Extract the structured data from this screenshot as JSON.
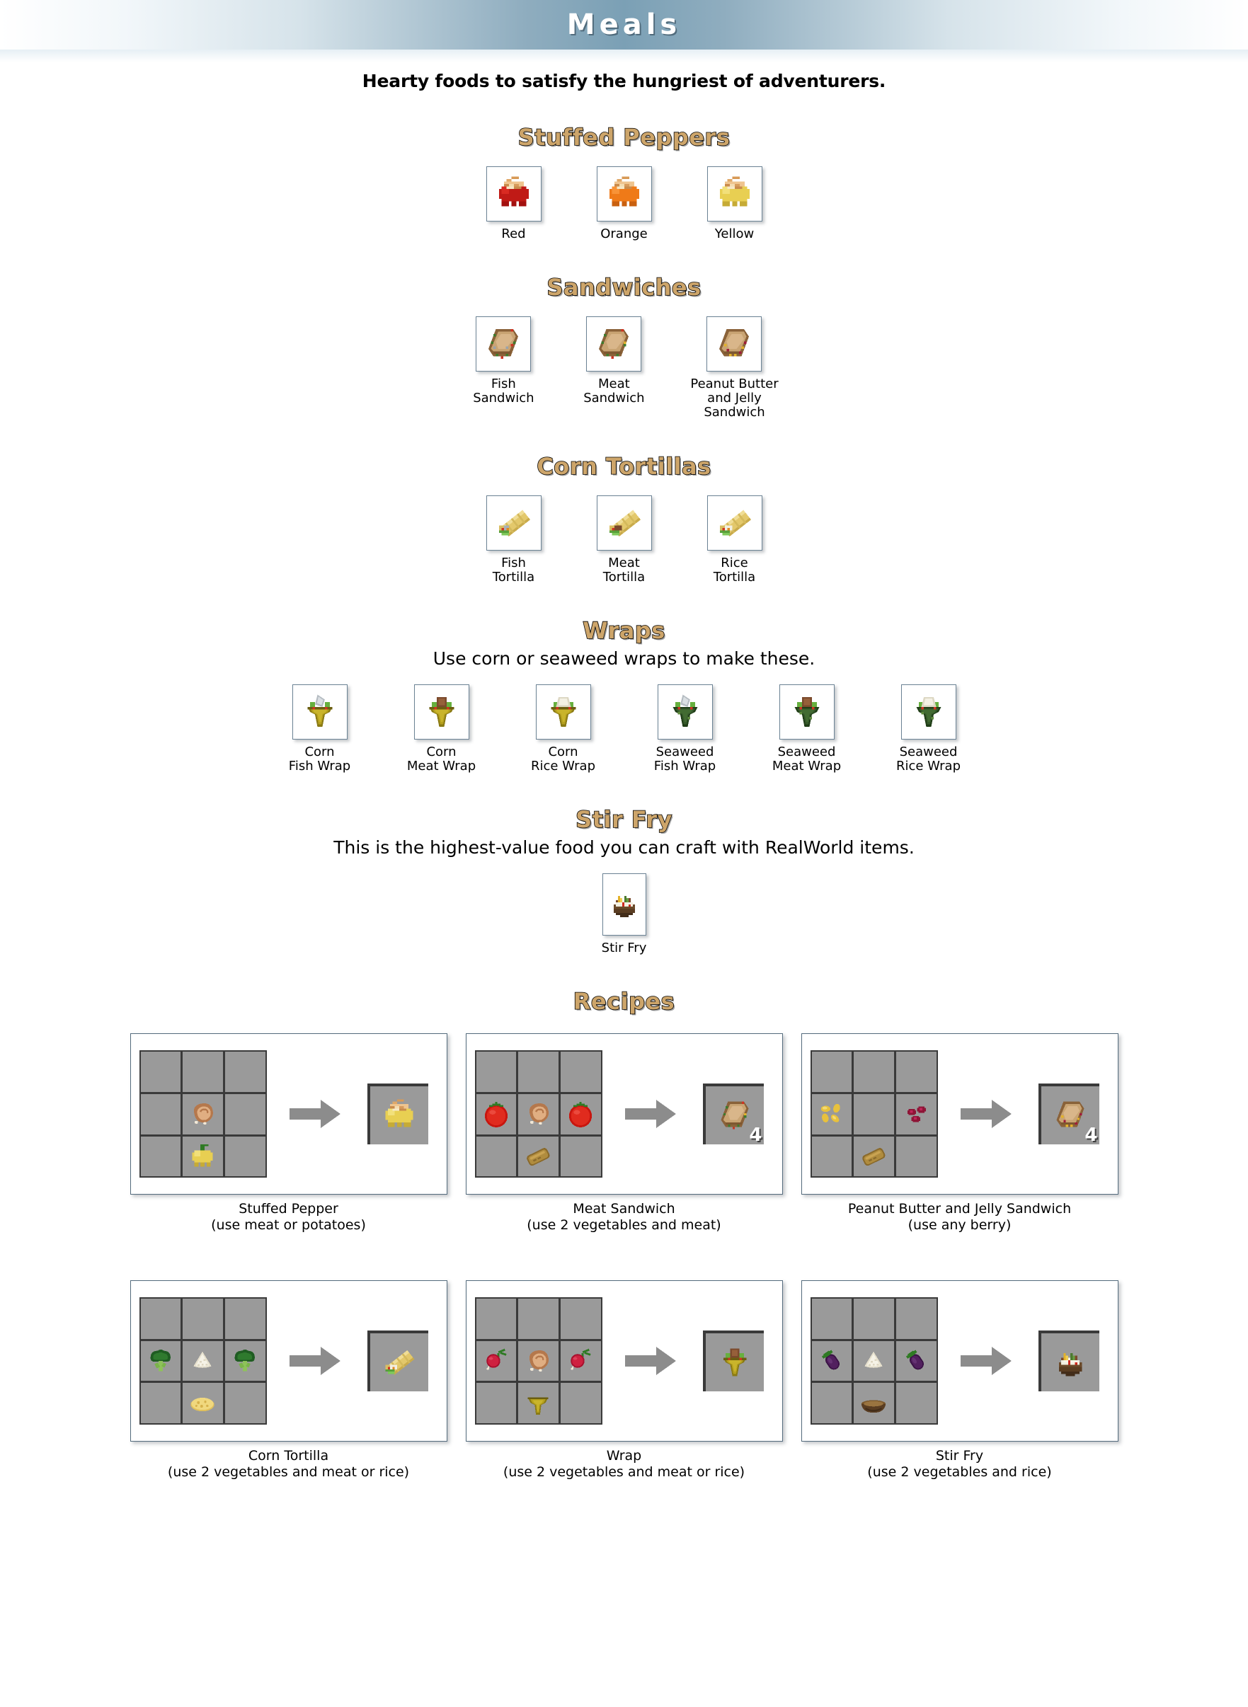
{
  "banner": {
    "title": "Meals"
  },
  "intro": "Hearty foods to satisfy the hungriest of adventurers.",
  "sections": [
    {
      "heading": "Stuffed Peppers",
      "subtitle": "",
      "items": [
        {
          "label": "Red",
          "icon": "stuffed-pepper-red-icon"
        },
        {
          "label": "Orange",
          "icon": "stuffed-pepper-orange-icon"
        },
        {
          "label": "Yellow",
          "icon": "stuffed-pepper-yellow-icon"
        }
      ]
    },
    {
      "heading": "Sandwiches",
      "subtitle": "",
      "items": [
        {
          "label": "Fish\nSandwich",
          "icon": "fish-sandwich-icon"
        },
        {
          "label": "Meat\nSandwich",
          "icon": "meat-sandwich-icon"
        },
        {
          "label": "Peanut Butter\nand Jelly\nSandwich",
          "icon": "pbj-sandwich-icon"
        }
      ]
    },
    {
      "heading": "Corn Tortillas",
      "subtitle": "",
      "items": [
        {
          "label": "Fish\nTortilla",
          "icon": "fish-tortilla-icon"
        },
        {
          "label": "Meat\nTortilla",
          "icon": "meat-tortilla-icon"
        },
        {
          "label": "Rice\nTortilla",
          "icon": "rice-tortilla-icon"
        }
      ]
    },
    {
      "heading": "Wraps",
      "subtitle": "Use corn or seaweed wraps to make these.",
      "items": [
        {
          "label": "Corn\nFish Wrap",
          "icon": "corn-fish-wrap-icon"
        },
        {
          "label": "Corn\nMeat Wrap",
          "icon": "corn-meat-wrap-icon"
        },
        {
          "label": "Corn\nRice Wrap",
          "icon": "corn-rice-wrap-icon"
        },
        {
          "label": "Seaweed\nFish Wrap",
          "icon": "seaweed-fish-wrap-icon"
        },
        {
          "label": "Seaweed\nMeat Wrap",
          "icon": "seaweed-meat-wrap-icon"
        },
        {
          "label": "Seaweed\nRice Wrap",
          "icon": "seaweed-rice-wrap-icon"
        }
      ]
    },
    {
      "heading": "Stir Fry",
      "subtitle": "This is the highest-value food you can craft with RealWorld items.",
      "items": [
        {
          "label": "Stir Fry",
          "icon": "stir-fry-icon"
        }
      ]
    }
  ],
  "recipes_heading": "Recipes",
  "recipes": [
    {
      "caption": "Stuffed Pepper\n(use meat or potatoes)",
      "grid": [
        "",
        "",
        "",
        "",
        "cooked-meat-icon",
        "",
        "",
        "yellow-pepper-icon",
        ""
      ],
      "result": "stuffed-pepper-yellow-icon",
      "count": ""
    },
    {
      "caption": "Meat Sandwich\n(use 2 vegetables and meat)",
      "grid": [
        "",
        "",
        "",
        "tomato-icon",
        "cooked-meat-icon",
        "tomato-icon",
        "",
        "bread-icon",
        ""
      ],
      "result": "meat-sandwich-icon",
      "count": "4"
    },
    {
      "caption": "Peanut Butter and Jelly Sandwich\n(use any berry)",
      "grid": [
        "",
        "",
        "",
        "peanuts-icon",
        "",
        "berries-icon",
        "",
        "bread-icon",
        ""
      ],
      "result": "pbj-sandwich-icon",
      "count": "4"
    },
    {
      "caption": "Corn Tortilla\n(use 2 vegetables and meat or rice)",
      "grid": [
        "",
        "",
        "",
        "broccoli-icon",
        "rice-icon",
        "broccoli-icon",
        "",
        "flatbread-icon",
        ""
      ],
      "result": "rice-tortilla-icon",
      "count": ""
    },
    {
      "caption": "Wrap\n(use 2 vegetables and meat or rice)",
      "grid": [
        "",
        "",
        "",
        "radish-icon",
        "cooked-meat-icon",
        "radish-icon",
        "",
        "corn-husk-icon",
        ""
      ],
      "result": "corn-meat-wrap-icon",
      "count": ""
    },
    {
      "caption": "Stir Fry\n(use 2 vegetables and rice)",
      "grid": [
        "",
        "",
        "",
        "eggplant-icon",
        "rice-icon",
        "eggplant-icon",
        "",
        "bowl-icon",
        ""
      ],
      "result": "stir-fry-icon",
      "count": ""
    }
  ],
  "colors": {
    "heading": "#cda56a",
    "banner_center": "#7ba0b5",
    "slot_border": "#6b8294",
    "cell_gray": "#9a9a9a",
    "grid_line": "#3a3a3a",
    "arrow": "#8c8c8c"
  }
}
